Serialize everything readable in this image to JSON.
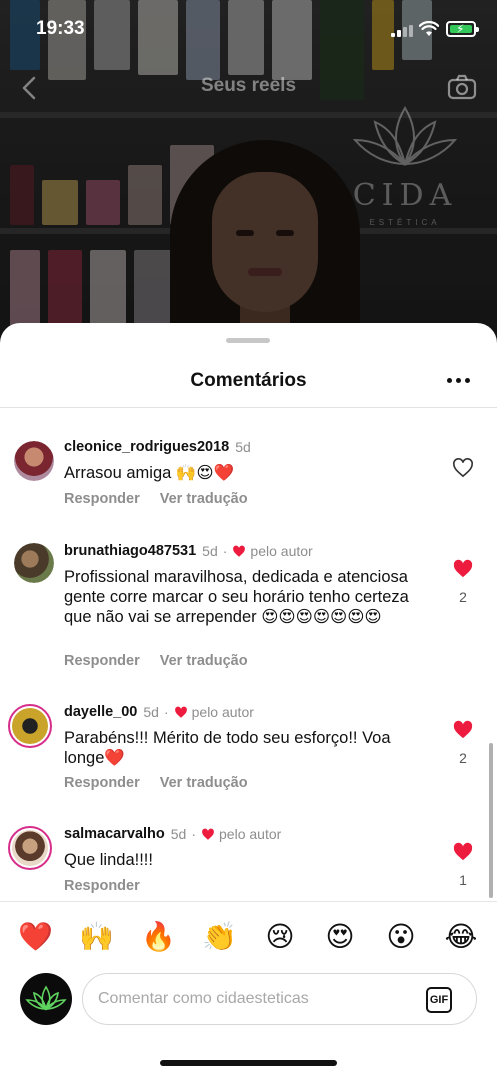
{
  "status_bar": {
    "time": "19:33"
  },
  "header": {
    "title": "Seus reels",
    "watermark": "CIDA",
    "watermark_sub": "ESTÉTICA"
  },
  "sheet": {
    "title": "Comentários"
  },
  "comments": [
    {
      "username": "cleonice_rodrigues2018",
      "time": "5d",
      "author_liked": false,
      "author_label": "",
      "text": "Arrasou  amiga 🙌😍❤️",
      "actions": [
        "Responder",
        "Ver tradução"
      ],
      "liked": false,
      "likes": ""
    },
    {
      "username": "brunathiago487531",
      "time": "5d",
      "author_liked": true,
      "author_label": "pelo autor",
      "text": "Profissional maravilhosa, dedicada e atenciosa gente corre marcar o seu horário tenho certeza que não vai se arrepender 😍😍😍😍😍😍😍",
      "actions": [
        "Responder",
        "Ver tradução"
      ],
      "liked": true,
      "likes": "2"
    },
    {
      "username": "dayelle_00",
      "time": "5d",
      "author_liked": true,
      "author_label": "pelo autor",
      "text": "Parabéns!!! Mérito de todo seu esforço!! Voa longe❤️",
      "actions": [
        "Responder",
        "Ver tradução"
      ],
      "liked": true,
      "likes": "2"
    },
    {
      "username": "salmacarvalho",
      "time": "5d",
      "author_liked": true,
      "author_label": "pelo autor",
      "text": "Que linda!!!!",
      "actions": [
        "Responder"
      ],
      "liked": true,
      "likes": "1"
    }
  ],
  "quick_emojis": [
    {
      "name": "red-heart",
      "char": "❤️"
    },
    {
      "name": "raising-hands",
      "char": "🙌"
    },
    {
      "name": "fire",
      "char": "🔥"
    },
    {
      "name": "clapping-hands",
      "char": "👏"
    },
    {
      "name": "crying-face",
      "char": "😢"
    },
    {
      "name": "heart-eyes",
      "char": "😍"
    },
    {
      "name": "surprised-face",
      "char": "😮"
    },
    {
      "name": "laughing-tears",
      "char": "😂"
    }
  ],
  "composer": {
    "placeholder": "Comentar como cidaesteticas",
    "gif_label": "GIF"
  },
  "colors": {
    "like_red": "#ed1c3e",
    "accent_ring": "#d62d8a",
    "muted": "#8e8e8e"
  }
}
